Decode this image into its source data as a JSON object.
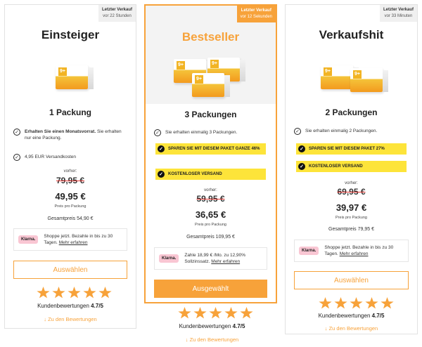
{
  "cards": [
    {
      "last_sale_label": "Letzter Verkauf",
      "last_sale_time": "vor 22 Stunden",
      "title": "Einsteiger",
      "pack_title": "1 Packung",
      "feature_1_bold": "Erhalten Sie einen Monatsvorrat.",
      "feature_1_rest": " Sie erhalten nur eine Packung.",
      "feature_2": "4,95 EUR Versandkosten",
      "before_label": "vorher:",
      "old_price": "79,95 €",
      "new_price": "49,95 €",
      "unit_label": "Preis pro Packung",
      "total": "Gesamtpreis 54,90 €",
      "klarna_badge": "Klarna.",
      "klarna_text": "Shoppe jetzt. Bezahle in bis zu 30 Tagen.",
      "klarna_link": "Mehr erfahren",
      "button": "Auswählen",
      "reviews_label": "Kundenbewertungen",
      "reviews_score": "4.7/5",
      "review_link": "Zu den Bewertungen",
      "rating": 5
    },
    {
      "last_sale_label": "Letzter Verkauf",
      "last_sale_time": "vor 12 Sekunden",
      "title": "Bestseller",
      "pack_title": "3 Packungen",
      "feature_1": "Sie erhalten einmalig 3 Packungen.",
      "highlight_1": "SPAREN SIE MIT DIESEM PAKET GANZE 46%",
      "highlight_2": "KOSTENLOSER VERSAND",
      "before_label": "vorher:",
      "old_price": "59,95 €",
      "new_price": "36,65 €",
      "unit_label": "Preis pro Packung",
      "total": "Gesamtpreis 109,95 €",
      "klarna_badge": "Klarna.",
      "klarna_text": "Zahle 18,99 € /Mo. zu 12,90% Sollzinssatz.",
      "klarna_link": "Mehr erfahren",
      "button": "Ausgewählt",
      "reviews_label": "Kundenbewertungen",
      "reviews_score": "4.7/5",
      "review_link": "Zu den Bewertungen",
      "rating": 5
    },
    {
      "last_sale_label": "Letzter Verkauf",
      "last_sale_time": "vor 33 Minuten",
      "title": "Verkaufshit",
      "pack_title": "2 Packungen",
      "feature_1": "Sie erhalten einmalig 2 Packungen.",
      "highlight_1": "SPAREN SIE MIT DIESEM PAKET 27%",
      "highlight_2": "KOSTENLOSER VERSAND",
      "before_label": "vorher:",
      "old_price": "69,95 €",
      "new_price": "39,97 €",
      "unit_label": "Preis pro Packung",
      "total": "Gesamtpreis 79,95 €",
      "klarna_badge": "Klarna.",
      "klarna_text": "Shoppe jetzt. Bezahle in bis zu 30 Tagen.",
      "klarna_link": "Mehr erfahren",
      "button": "Auswählen",
      "reviews_label": "Kundenbewertungen",
      "reviews_score": "4.7/5",
      "review_link": "Zu den Bewertungen",
      "rating": 5
    }
  ],
  "colors": {
    "accent": "#f7a23a",
    "highlight": "#fde43a",
    "strike": "#e53935",
    "klarna": "#f9c6d3"
  },
  "icons": {
    "check": "check-circle-icon",
    "star": "star-icon",
    "arrow": "arrow-down-icon"
  }
}
